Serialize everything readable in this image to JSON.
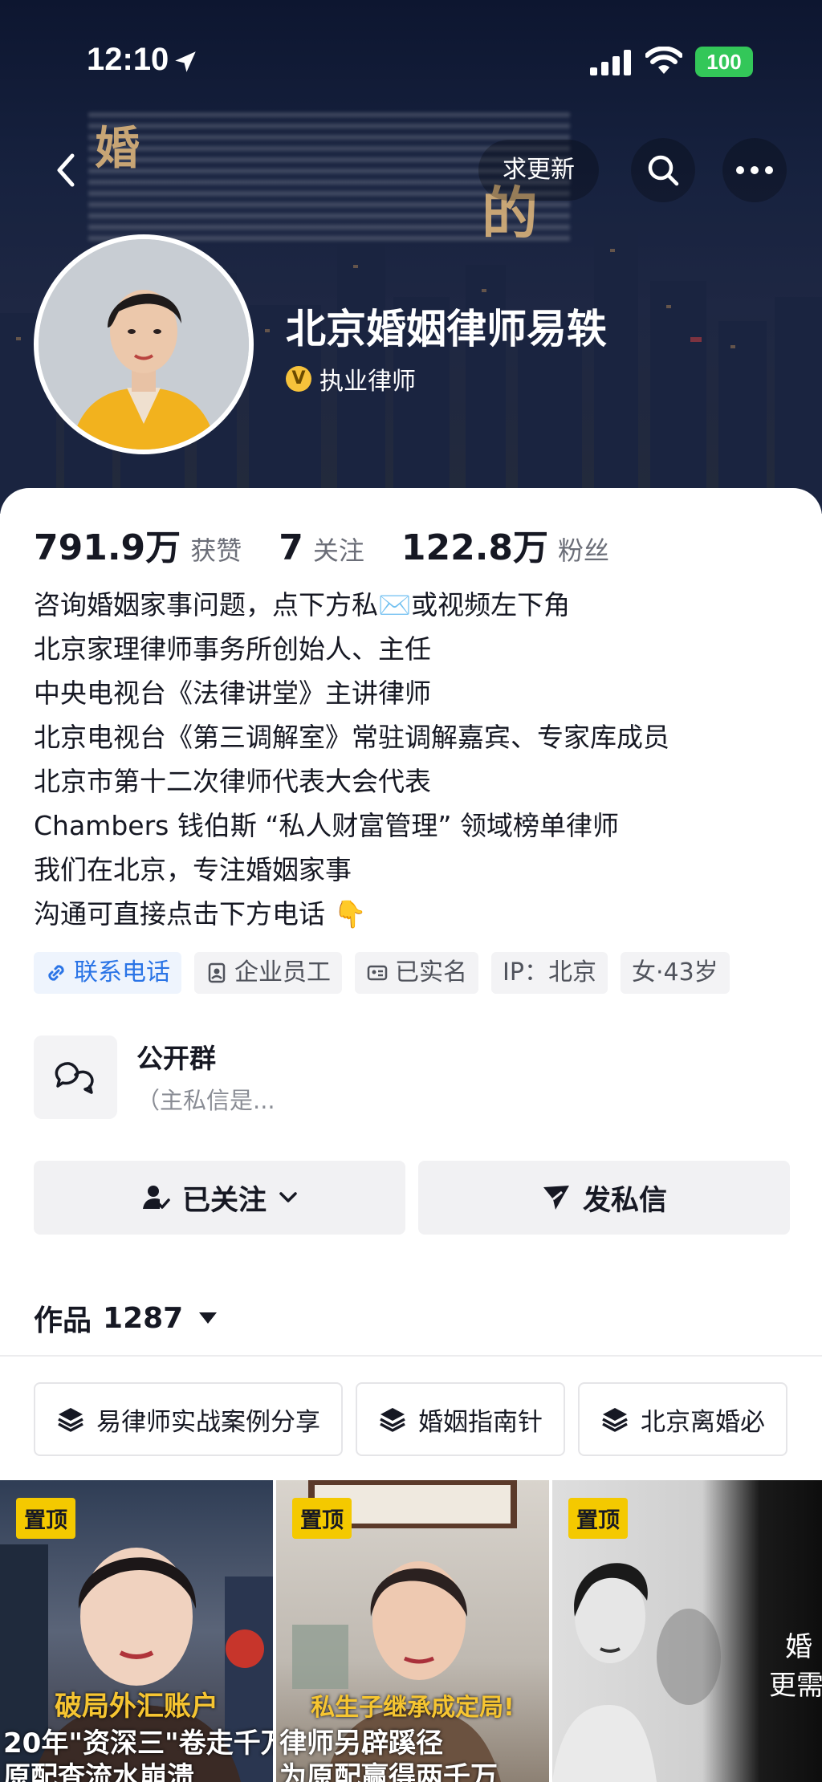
{
  "status_bar": {
    "time": "12:10",
    "battery": "100"
  },
  "header": {
    "cover_chars": [
      "婚",
      "的"
    ],
    "request_update_label": "求更新",
    "display_name": "北京婚姻律师易轶",
    "verify_badge": "V",
    "verify_text": "执业律师"
  },
  "stats": [
    {
      "value": "791.9万",
      "label": "获赞"
    },
    {
      "value": "7",
      "label": "关注"
    },
    {
      "value": "122.8万",
      "label": "粉丝"
    }
  ],
  "bio": [
    "咨询婚姻家事问题，点下方私✉️或视频左下角",
    "北京家理律师事务所创始人、主任",
    "中央电视台《法律讲堂》主讲律师",
    "北京电视台《第三调解室》常驻调解嘉宾、专家库成员",
    "北京市第十二次律师代表大会代表",
    "Chambers 钱伯斯 “私人财富管理” 领域榜单律师",
    "我们在北京，专注婚姻家事",
    "沟通可直接点击下方电话 👇"
  ],
  "tags": {
    "contact": "联系电话",
    "employee": "企业员工",
    "verified": "已实名",
    "ip": "IP：北京",
    "gender_age": "女·43岁"
  },
  "group": {
    "title": "公开群",
    "subtitle": "（主私信是..."
  },
  "actions": {
    "following": "已关注",
    "message": "发私信"
  },
  "works": {
    "label": "作品",
    "count": "1287"
  },
  "collections": [
    "易律师实战案例分享",
    "婚姻指南针",
    "北京离婚必"
  ],
  "videos": [
    {
      "pin": "置顶",
      "caption_top": "破局外汇账户",
      "caption_bottom": "20年\"资深三\"卷走千万",
      "caption_bottom2": "原配查流水崩溃"
    },
    {
      "pin": "置顶",
      "caption_top": "私生子继承成定局!",
      "caption_bottom": "律师另辟蹊径",
      "caption_bottom2": "为原配赢得两千万"
    },
    {
      "pin": "置顶",
      "caption_top": "婚",
      "caption_bottom": "更需",
      "caption_bottom2": ""
    }
  ],
  "colors": {
    "accent_link": "#2a74e6",
    "pin_yellow": "#f4c900",
    "battery_green": "#33c759",
    "verify_gold": "#f6c23b"
  }
}
